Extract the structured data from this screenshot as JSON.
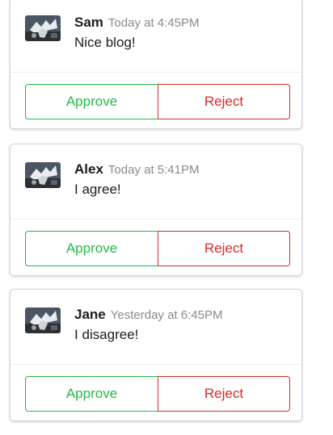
{
  "comments": [
    {
      "author": "Sam",
      "timestamp": "Today at 4:45PM",
      "text": "Nice blog!",
      "approve_label": "Approve",
      "reject_label": "Reject"
    },
    {
      "author": "Alex",
      "timestamp": "Today at 5:41PM",
      "text": "I agree!",
      "approve_label": "Approve",
      "reject_label": "Reject"
    },
    {
      "author": "Jane",
      "timestamp": "Yesterday at 6:45PM",
      "text": "I disagree!",
      "approve_label": "Approve",
      "reject_label": "Reject"
    }
  ],
  "colors": {
    "approve": "#21ba45",
    "reject": "#db2828",
    "timestamp": "#8a8a8a",
    "card_border": "#d4d4d5"
  },
  "icons": {
    "avatar": "avatar-photo-icon"
  }
}
